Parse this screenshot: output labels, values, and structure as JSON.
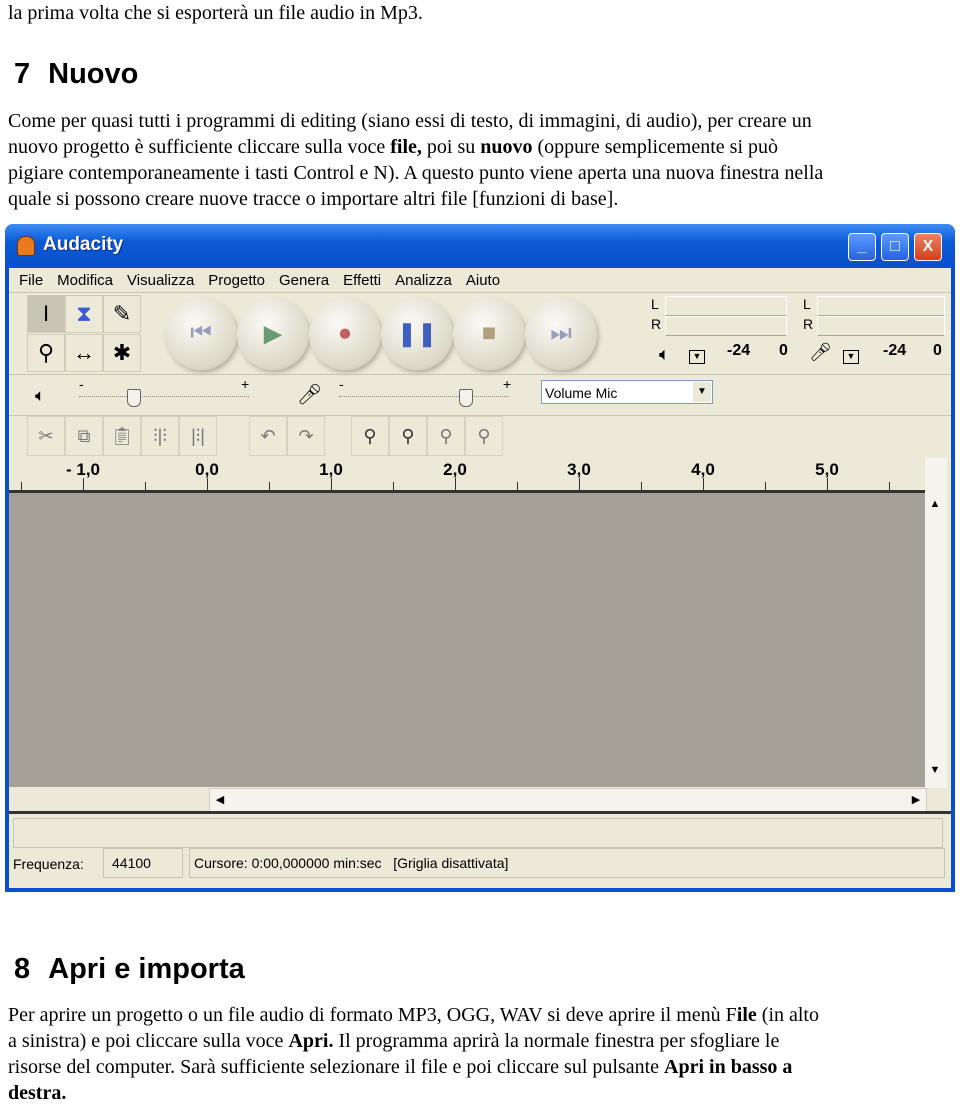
{
  "doc": {
    "intro_line": "la prima volta che si esporterà un file audio in Mp3.",
    "section7": {
      "number": "7",
      "title": "Nuovo",
      "lines": [
        "Come per quasi tutti i programmi di editing (siano essi di testo, di immagini, di audio), per creare un",
        "nuovo progetto è sufficiente cliccare sulla voce ",
        "file,",
        " poi su ",
        "nuovo",
        " (oppure semplicemente si può",
        "pigiare contemporaneamente i tasti Control e N). A questo punto viene aperta una nuova finestra nella",
        "quale si possono creare nuove tracce o importare altri file [funzioni di base]."
      ]
    },
    "section8": {
      "number": "8",
      "title": "Apri e importa",
      "l1a": "Per aprire un progetto o un file audio di formato MP3, OGG, WAV si deve aprire il menù F",
      "l1b": "ile",
      " l1c": " (in alto",
      "l1c": " (in alto",
      "l2a": "a sinistra) e poi cliccare sulla voce ",
      "l2b": "Apri.",
      "l2c": " Il programma aprirà la normale finestra per sfogliare le",
      "l3": "risorse del computer. Sarà sufficiente selezionare il file e poi cliccare sul pulsante ",
      "l3b": "Apri in basso a",
      "l4": "destra."
    }
  },
  "app": {
    "title": "Audacity",
    "window_buttons": [
      "_",
      "□",
      "X"
    ],
    "menu": [
      "File",
      "Modifica",
      "Visualizza",
      "Progetto",
      "Genera",
      "Effetti",
      "Analizza",
      "Aiuto"
    ],
    "meters": {
      "L": "L",
      "R": "R",
      "m24": "-24",
      "zero": "0"
    },
    "slider_minus": "-",
    "slider_plus": "+",
    "output_volume": 0.3,
    "input_volume": 0.75,
    "input_source": "Volume Mic",
    "ruler_labels": [
      "- 1,0",
      "0,0",
      "1,0",
      "2,0",
      "3,0",
      "4,0",
      "5,0"
    ],
    "status": {
      "freq_label": "Frequenza:",
      "freq_value": "44100",
      "cursor": "Cursore: 0:00,000000 min:sec",
      "grid": "[Griglia disattivata]"
    }
  }
}
